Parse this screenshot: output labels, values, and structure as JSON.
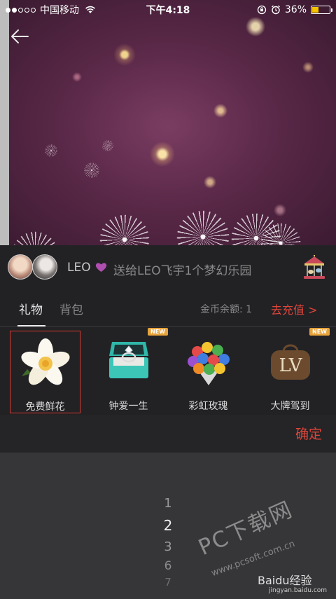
{
  "status_bar": {
    "carrier": "中国移动",
    "time": "下午4:18",
    "battery_percent": "36%",
    "battery_level": 0.36,
    "signal_bars": 2
  },
  "sender": {
    "name": "LEO",
    "message": "送给LEO飞宇1个梦幻乐园"
  },
  "tabs": {
    "gift": "礼物",
    "bag": "背包"
  },
  "coins": {
    "label": "金币余额: 1",
    "recharge": "去充值 >"
  },
  "gifts": [
    {
      "name": "免费鲜花",
      "icon": "flower-icon",
      "selected": true
    },
    {
      "name": "钟爱一生",
      "icon": "ring-box-icon",
      "badge": "NEW"
    },
    {
      "name": "彩虹玫瑰",
      "icon": "rainbow-rose-icon"
    },
    {
      "name": "大牌驾到",
      "icon": "lv-bag-icon",
      "badge": "NEW"
    }
  ],
  "confirm": "确定",
  "picker": [
    "1",
    "2",
    "3",
    "6",
    "7"
  ],
  "watermarks": {
    "big": "PC下载网",
    "url": "www.pcsoft.com.cn",
    "baidu": "Baidu经验",
    "baidu_sub": "jingyan.baidu.com"
  },
  "colors": {
    "accent": "#e0453a",
    "battery": "#f5c400",
    "panel": "#222225"
  }
}
